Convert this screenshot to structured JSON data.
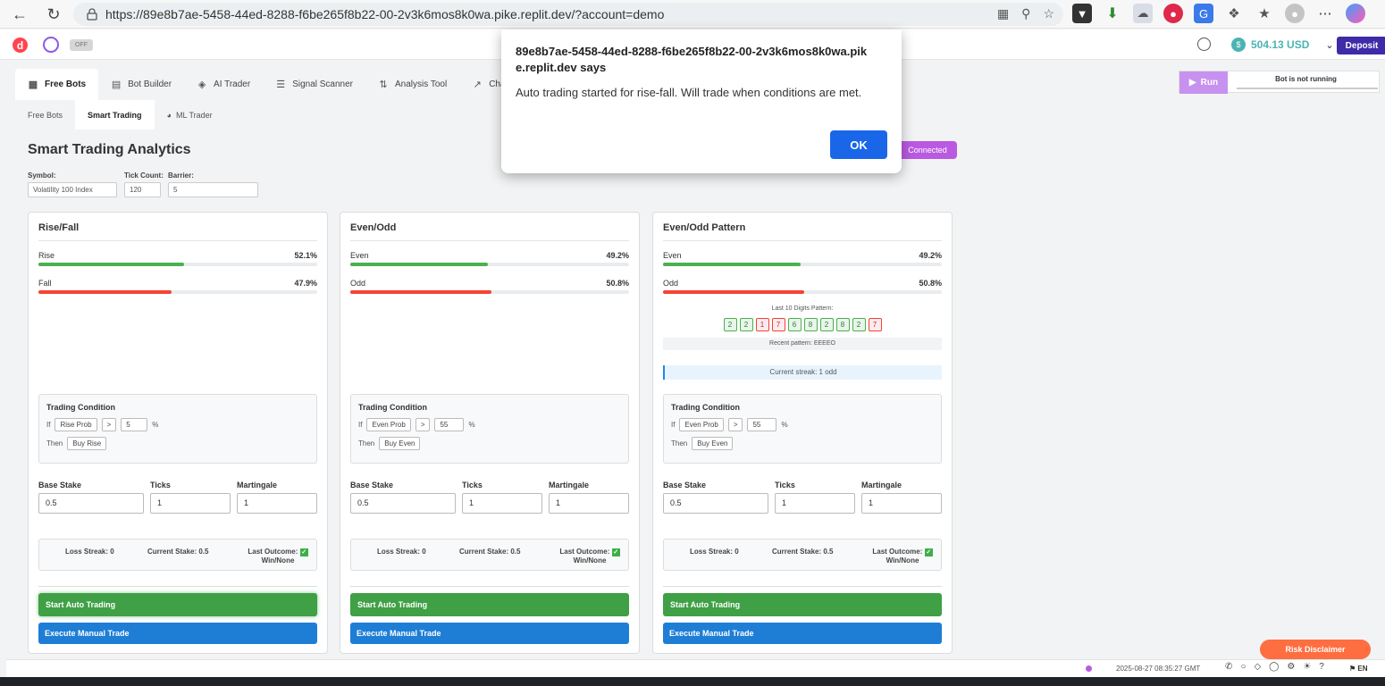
{
  "browser": {
    "url": "https://89e8b7ae-5458-44ed-8288-f6be265f8b22-00-2v3k6mos8k0wa.pike.replit.dev/?account=demo"
  },
  "header": {
    "off_label": "OFF",
    "balance": "504.13 USD",
    "deposit_label": "Deposit"
  },
  "main_tabs": [
    {
      "label": "Free Bots",
      "icon": "grid-icon"
    },
    {
      "label": "Bot Builder",
      "icon": "bot-icon"
    },
    {
      "label": "AI Trader",
      "icon": "layers-icon"
    },
    {
      "label": "Signal Scanner",
      "icon": "list-icon"
    },
    {
      "label": "Analysis Tool",
      "icon": "sliders-icon"
    },
    {
      "label": "Charts",
      "icon": "chart-icon"
    }
  ],
  "run": {
    "label": "Run",
    "status": "Bot is not running"
  },
  "sub_tabs": [
    {
      "label": "Free Bots"
    },
    {
      "label": "Smart Trading"
    },
    {
      "label": "ML Trader"
    }
  ],
  "page": {
    "title": "Smart Trading Analytics",
    "connection": "Connected"
  },
  "params": {
    "symbol_label": "Symbol:",
    "symbol_value": "Volatility 100 Index",
    "tick_label": "Tick Count:",
    "tick_value": "120",
    "barrier_label": "Barrier:",
    "barrier_value": "5"
  },
  "cards": [
    {
      "title": "Rise/Fall",
      "a_label": "Rise",
      "a_pct": "52.1%",
      "a_value": 52.1,
      "b_label": "Fall",
      "b_pct": "47.9%",
      "b_value": 47.9,
      "cond_title": "Trading Condition",
      "if_label": "If",
      "cond_field": "Rise Prob",
      "cond_op": ">",
      "cond_value": "5",
      "cond_unit": "%",
      "then_label": "Then",
      "cond_action": "Buy Rise",
      "stake_label": "Base Stake",
      "stake": "0.5",
      "ticks_label": "Ticks",
      "ticks": "1",
      "mart_label": "Martingale",
      "mart": "1",
      "loss_streak": "Loss Streak: 0",
      "current_stake": "Current Stake: 0.5",
      "last_outcome": "Last Outcome:",
      "outcome_value": "Win/None",
      "auto_label": "Start Auto Trading",
      "manual_label": "Execute Manual Trade"
    },
    {
      "title": "Even/Odd",
      "a_label": "Even",
      "a_pct": "49.2%",
      "a_value": 49.2,
      "b_label": "Odd",
      "b_pct": "50.8%",
      "b_value": 50.8,
      "cond_title": "Trading Condition",
      "if_label": "If",
      "cond_field": "Even Prob",
      "cond_op": ">",
      "cond_value": "55",
      "cond_unit": "%",
      "then_label": "Then",
      "cond_action": "Buy Even",
      "stake_label": "Base Stake",
      "stake": "0.5",
      "ticks_label": "Ticks",
      "ticks": "1",
      "mart_label": "Martingale",
      "mart": "1",
      "loss_streak": "Loss Streak: 0",
      "current_stake": "Current Stake: 0.5",
      "last_outcome": "Last Outcome:",
      "outcome_value": "Win/None",
      "auto_label": "Start Auto Trading",
      "manual_label": "Execute Manual Trade"
    },
    {
      "title": "Even/Odd Pattern",
      "a_label": "Even",
      "a_pct": "49.2%",
      "a_value": 49.2,
      "b_label": "Odd",
      "b_pct": "50.8%",
      "b_value": 50.8,
      "pattern_label": "Last 10 Digits Pattern:",
      "digits": [
        "2",
        "2",
        "1",
        "7",
        "6",
        "8",
        "2",
        "8",
        "2",
        "7"
      ],
      "recent_pattern": "Recent pattern: EEEEO",
      "streak": "Current streak: 1 odd",
      "cond_title": "Trading Condition",
      "if_label": "If",
      "cond_field": "Even Prob",
      "cond_op": ">",
      "cond_value": "55",
      "cond_unit": "%",
      "then_label": "Then",
      "cond_action": "Buy Even",
      "stake_label": "Base Stake",
      "stake": "0.5",
      "ticks_label": "Ticks",
      "ticks": "1",
      "mart_label": "Martingale",
      "mart": "1",
      "loss_streak": "Loss Streak: 0",
      "current_stake": "Current Stake: 0.5",
      "last_outcome": "Last Outcome:",
      "outcome_value": "Win/None",
      "auto_label": "Start Auto Trading",
      "manual_label": "Execute Manual Trade"
    }
  ],
  "dialog": {
    "title": "89e8b7ae-5458-44ed-8288-f6be265f8b22-00-2v3k6mos8k0wa.pike.replit.dev says",
    "message": "Auto trading started for rise-fall. Will trade when conditions are met.",
    "ok_label": "OK"
  },
  "footer": {
    "timestamp": "2025-08-27 08:35:27 GMT",
    "language": "EN",
    "risk_label": "Risk Disclaimer"
  },
  "colors": {
    "accent_purple": "#b95ae0",
    "green": "#4caf50",
    "red": "#f44336",
    "blue": "#1e7ed6",
    "deposit": "#3e2ba8",
    "balance": "#4bb4b3"
  }
}
